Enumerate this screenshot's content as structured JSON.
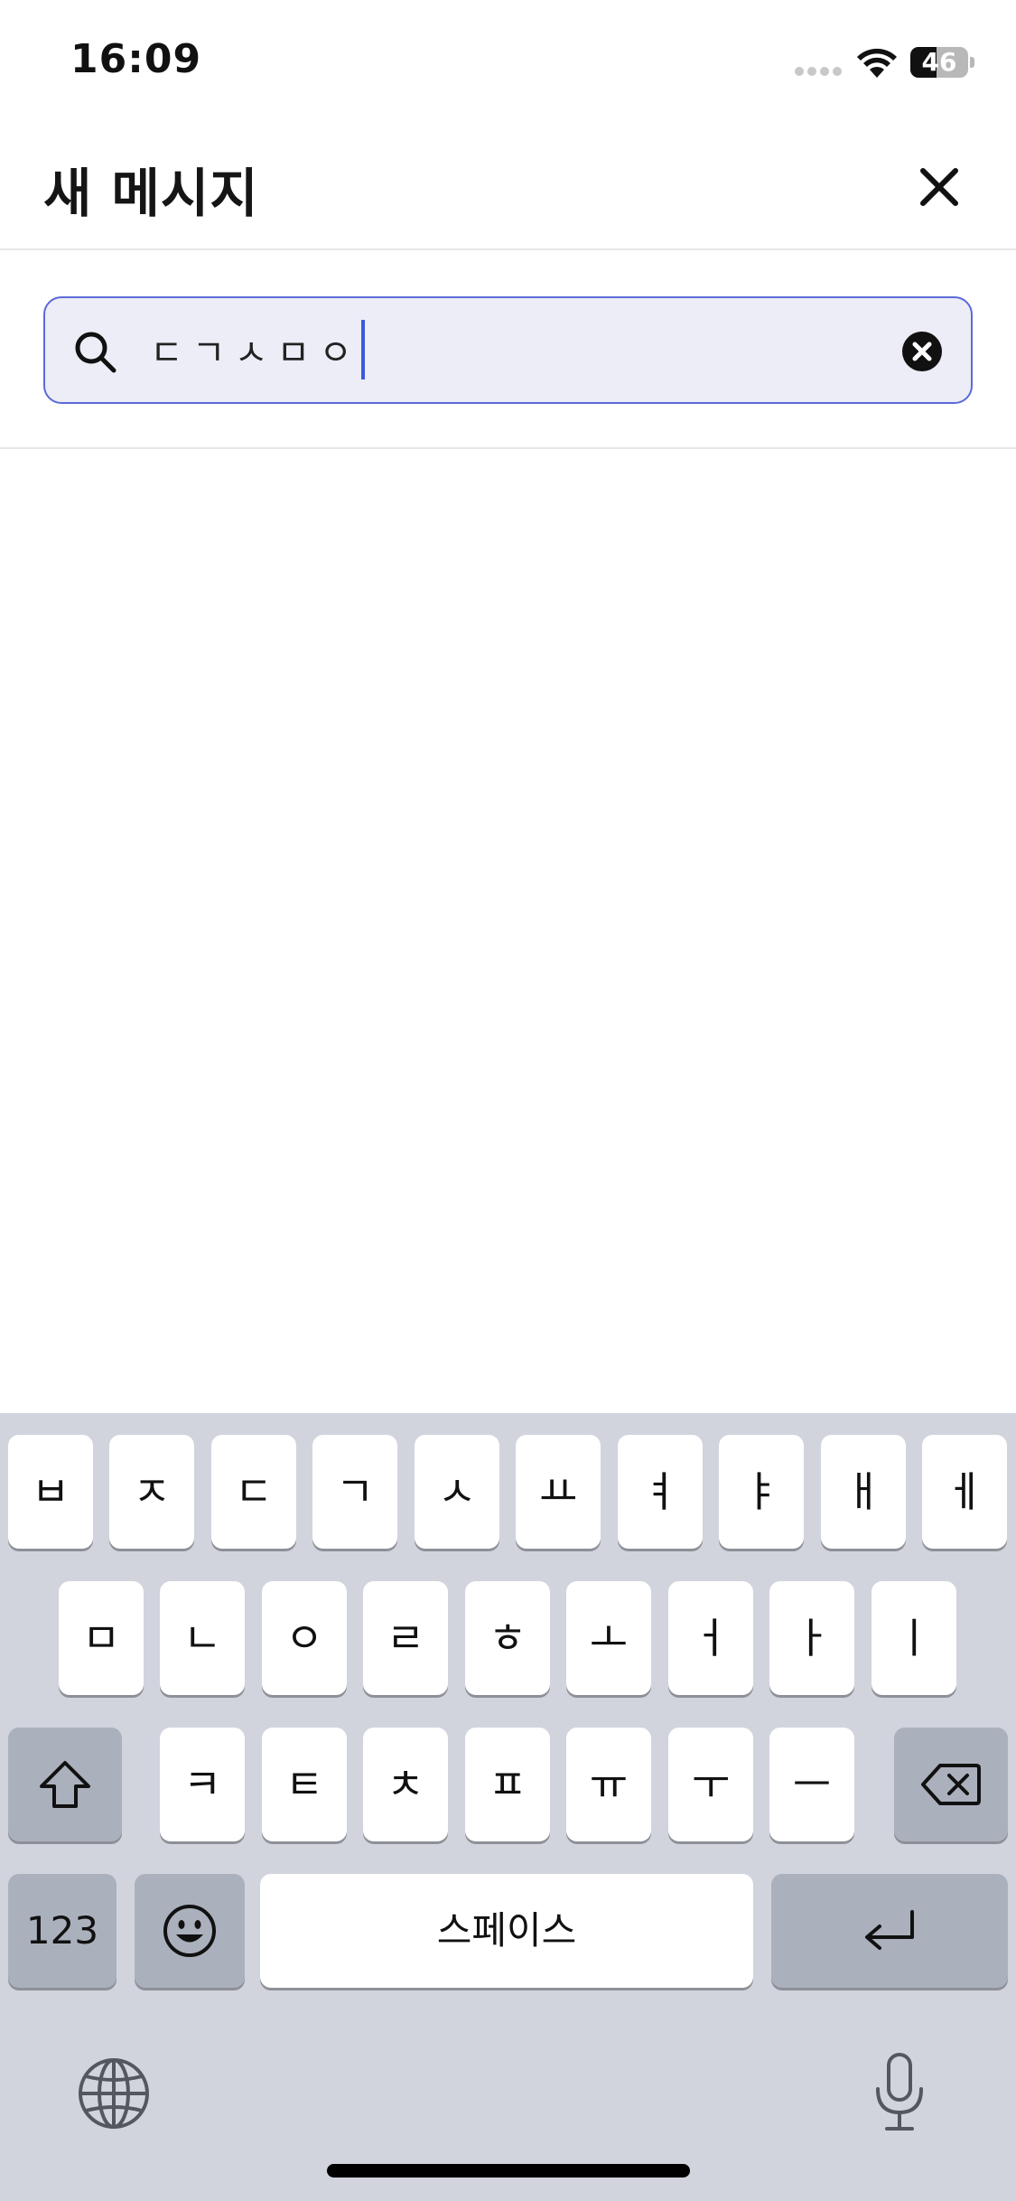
{
  "status_bar": {
    "time": "16:09",
    "battery_level": "46"
  },
  "header": {
    "title": "새 메시지",
    "close_icon": "close-icon"
  },
  "search": {
    "value": "ㄷㄱㅅㅁㅇ",
    "search_icon": "search-icon",
    "clear_icon": "clear-circle-icon",
    "border_color": "#5b6ad8",
    "background": "#ecedf6"
  },
  "keyboard": {
    "row1": [
      "ㅂ",
      "ㅈ",
      "ㄷ",
      "ㄱ",
      "ㅅ",
      "ㅛ",
      "ㅕ",
      "ㅑ",
      "ㅐ",
      "ㅔ"
    ],
    "row2": [
      "ㅁ",
      "ㄴ",
      "ㅇ",
      "ㄹ",
      "ㅎ",
      "ㅗ",
      "ㅓ",
      "ㅏ",
      "ㅣ"
    ],
    "row3": [
      "ㅋ",
      "ㅌ",
      "ㅊ",
      "ㅍ",
      "ㅠ",
      "ㅜ",
      "ㅡ"
    ],
    "shift_icon": "shift-icon",
    "backspace_icon": "backspace-icon",
    "numbers_label": "123",
    "emoji_icon": "emoji-icon",
    "space_label": "스페이스",
    "return_icon": "return-icon",
    "globe_icon": "globe-icon",
    "mic_icon": "microphone-icon",
    "background": "#d1d4dd"
  }
}
